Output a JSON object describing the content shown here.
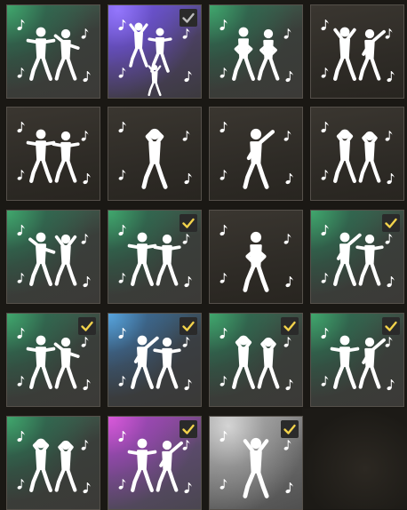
{
  "colors": {
    "check_active": "#f2d24b",
    "check_muted": "#bdbdbd",
    "figure": "#ffffff",
    "tile_border": "#55504a"
  },
  "emotes": [
    {
      "id": "emote-1",
      "background": "green",
      "equipped": false,
      "figure_count": 2
    },
    {
      "id": "emote-2",
      "background": "purple",
      "equipped": true,
      "check": "muted",
      "figure_count": 3
    },
    {
      "id": "emote-3",
      "background": "green",
      "equipped": false,
      "figure_count": 2
    },
    {
      "id": "emote-4",
      "background": "dark",
      "equipped": false,
      "figure_count": 2
    },
    {
      "id": "emote-5",
      "background": "dark",
      "equipped": false,
      "figure_count": 2
    },
    {
      "id": "emote-6",
      "background": "dark",
      "equipped": false,
      "figure_count": 1
    },
    {
      "id": "emote-7",
      "background": "dark",
      "equipped": false,
      "figure_count": 1
    },
    {
      "id": "emote-8",
      "background": "dark",
      "equipped": false,
      "figure_count": 2
    },
    {
      "id": "emote-9",
      "background": "green",
      "equipped": false,
      "figure_count": 2
    },
    {
      "id": "emote-10",
      "background": "green",
      "equipped": true,
      "check": "active",
      "figure_count": 2
    },
    {
      "id": "emote-11",
      "background": "dark",
      "equipped": false,
      "figure_count": 1
    },
    {
      "id": "emote-12",
      "background": "green",
      "equipped": true,
      "check": "active",
      "figure_count": 2
    },
    {
      "id": "emote-13",
      "background": "green",
      "equipped": true,
      "check": "active",
      "figure_count": 2
    },
    {
      "id": "emote-14",
      "background": "blue",
      "equipped": true,
      "check": "active",
      "figure_count": 2
    },
    {
      "id": "emote-15",
      "background": "green",
      "equipped": true,
      "check": "active",
      "figure_count": 2
    },
    {
      "id": "emote-16",
      "background": "green",
      "equipped": true,
      "check": "active",
      "figure_count": 2
    },
    {
      "id": "emote-17",
      "background": "green",
      "equipped": false,
      "figure_count": 2
    },
    {
      "id": "emote-18",
      "background": "magenta",
      "equipped": true,
      "check": "active",
      "figure_count": 2
    },
    {
      "id": "emote-19",
      "background": "silver",
      "equipped": true,
      "check": "active",
      "figure_count": 1
    }
  ]
}
